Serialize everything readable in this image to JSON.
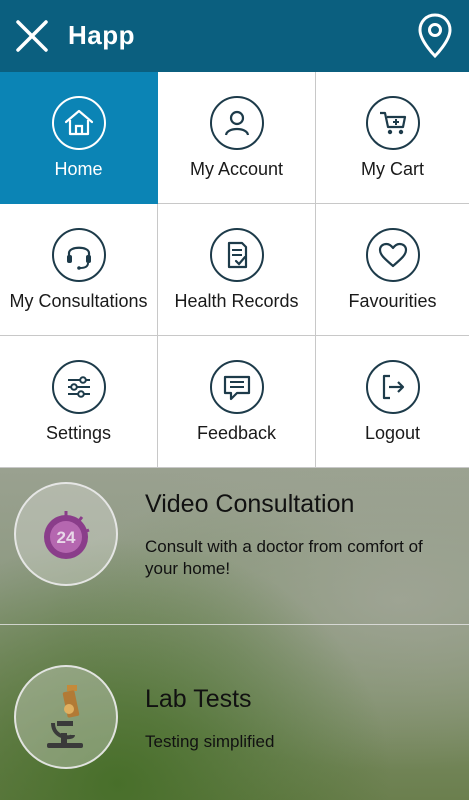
{
  "header": {
    "title": "Happ",
    "close_icon": "close-icon",
    "location_icon": "location-pin-icon",
    "bg_color": "#0b5f7f"
  },
  "menu": {
    "active_color": "#0b84b5",
    "items": [
      {
        "label": "Home",
        "icon": "home-icon",
        "active": true
      },
      {
        "label": "My Account",
        "icon": "user-icon",
        "active": false
      },
      {
        "label": "My Cart",
        "icon": "cart-icon",
        "active": false
      },
      {
        "label": "My Consultations",
        "icon": "headset-icon",
        "active": false
      },
      {
        "label": "Health Records",
        "icon": "records-icon",
        "active": false
      },
      {
        "label": "Favourities",
        "icon": "heart-icon",
        "active": false
      },
      {
        "label": "Settings",
        "icon": "sliders-icon",
        "active": false
      },
      {
        "label": "Feedback",
        "icon": "chat-icon",
        "active": false
      },
      {
        "label": "Logout",
        "icon": "logout-icon",
        "active": false
      }
    ]
  },
  "promos": [
    {
      "title": "Video Consultation",
      "description": "Consult with a doctor from comfort of your home!",
      "icon": "clock-24-icon"
    },
    {
      "title": "Lab Tests",
      "description": "Testing simplified",
      "icon": "microscope-icon"
    }
  ]
}
